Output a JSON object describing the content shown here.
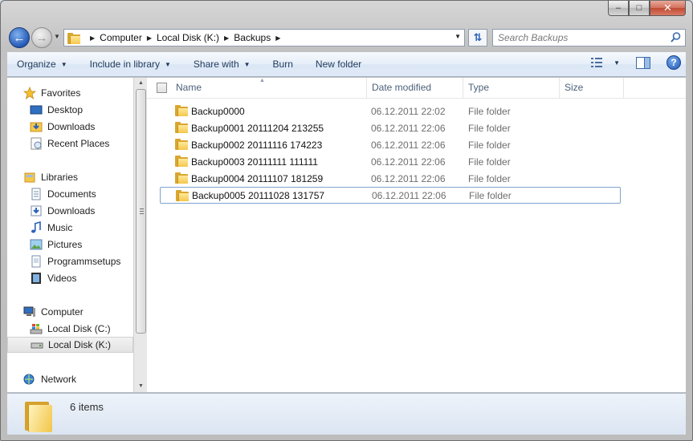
{
  "window": {
    "minimize_glyph": "–",
    "maximize_glyph": "□",
    "close_glyph": "✕"
  },
  "address": {
    "breadcrumbs": [
      "Computer",
      "Local Disk (K:)",
      "Backups"
    ]
  },
  "search": {
    "placeholder": "Search Backups"
  },
  "toolbar": {
    "organize": "Organize",
    "include_in_library": "Include in library",
    "share_with": "Share with",
    "burn": "Burn",
    "new_folder": "New folder"
  },
  "nav_pane": {
    "favorites": {
      "label": "Favorites",
      "items": [
        "Desktop",
        "Downloads",
        "Recent Places"
      ]
    },
    "libraries": {
      "label": "Libraries",
      "items": [
        "Documents",
        "Downloads",
        "Music",
        "Pictures",
        "Programmsetups",
        "Videos"
      ]
    },
    "computer": {
      "label": "Computer",
      "items": [
        "Local Disk (C:)",
        "Local Disk (K:)"
      ],
      "selected": "Local Disk (K:)"
    },
    "network": {
      "label": "Network"
    }
  },
  "columns": {
    "name": "Name",
    "date_modified": "Date modified",
    "type": "Type",
    "size": "Size"
  },
  "files": [
    {
      "name": "Backup0000",
      "date": "06.12.2011 22:02",
      "type": "File folder"
    },
    {
      "name": "Backup0001 20111204 213255",
      "date": "06.12.2011 22:06",
      "type": "File folder"
    },
    {
      "name": "Backup0002 20111116 174223",
      "date": "06.12.2011 22:06",
      "type": "File folder"
    },
    {
      "name": "Backup0003 20111111 111111",
      "date": "06.12.2011 22:06",
      "type": "File folder"
    },
    {
      "name": "Backup0004 20111107 181259",
      "date": "06.12.2011 22:06",
      "type": "File folder"
    },
    {
      "name": "Backup0005 20111028 131757",
      "date": "06.12.2011 22:06",
      "type": "File folder"
    }
  ],
  "focused_file": "Backup0005 20111028 131757",
  "details": {
    "item_count": "6 items"
  },
  "colors": {
    "accent": "#2559b8",
    "folder": "#f4c74d",
    "selection_border": "#7da2ce"
  }
}
